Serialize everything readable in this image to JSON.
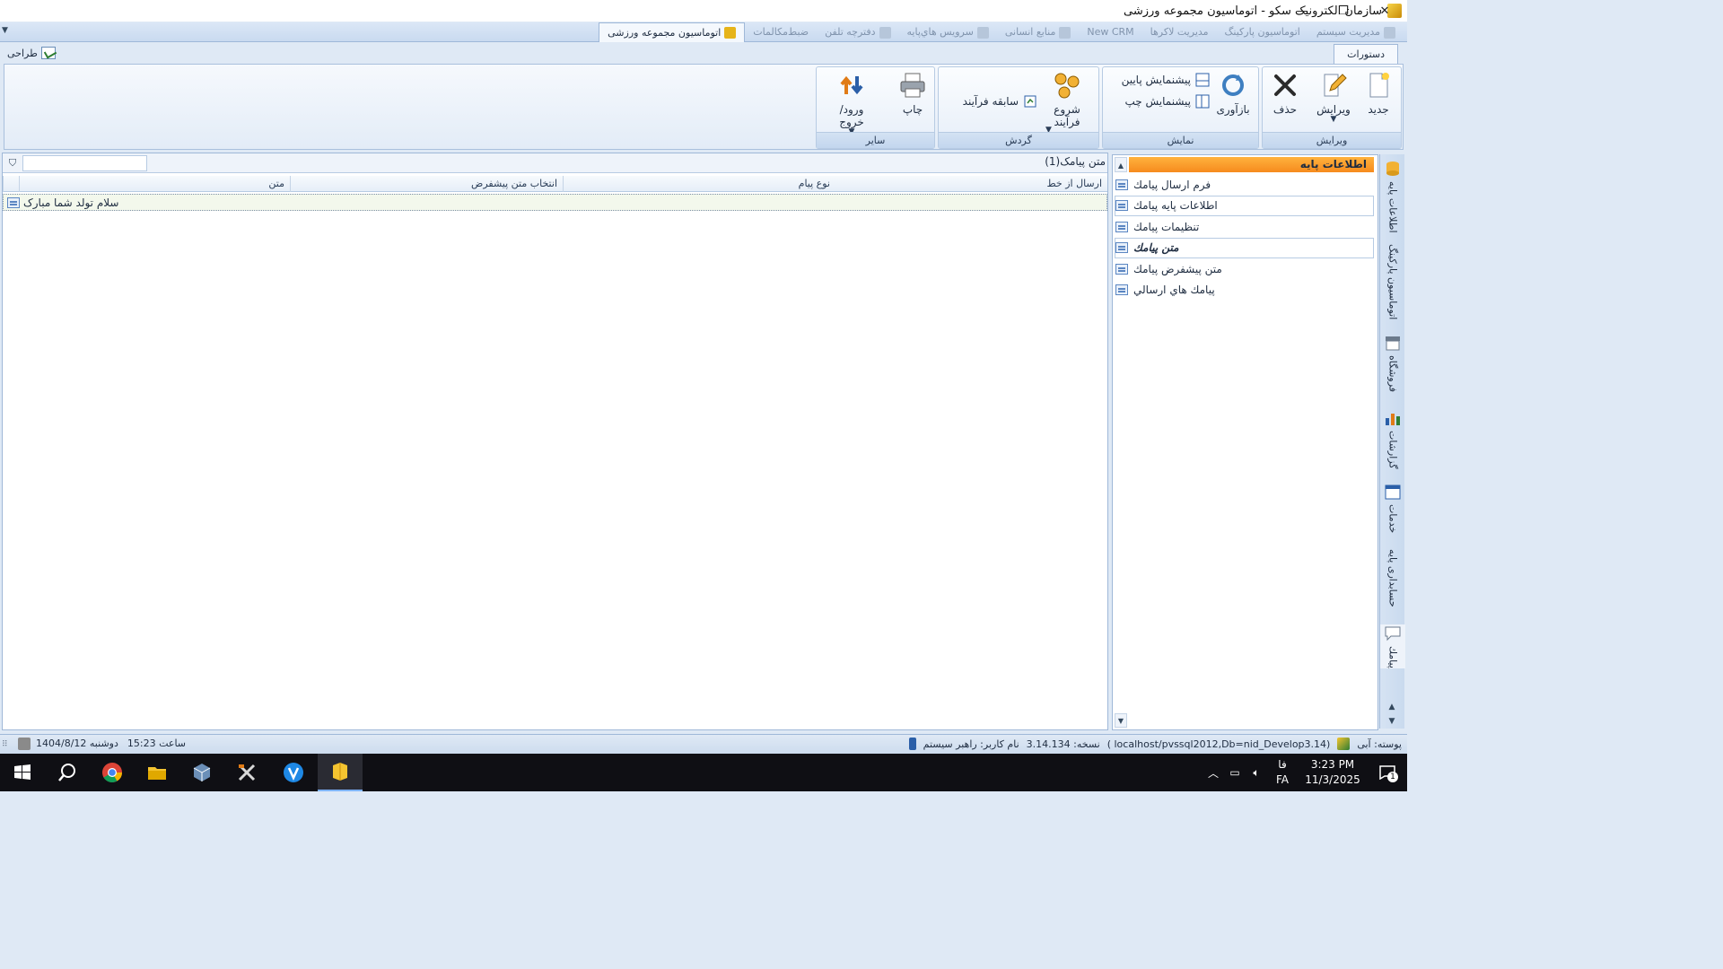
{
  "window": {
    "title": "سازمان الکترونیک سکو - اتوماسیون مجموعه ورزشی",
    "controls": {
      "minimize": "—",
      "restore": "❐",
      "close": "✕"
    }
  },
  "module_tabs": [
    {
      "label": "اتوماسيون مجموعه ورزشی",
      "active": true
    },
    {
      "label": "ضبط‌مکالمات",
      "active": false
    },
    {
      "label": "دفترچه تلفن",
      "active": false
    },
    {
      "label": "سرويس هاي‌پايه",
      "active": false
    },
    {
      "label": "منابع انسانی",
      "active": false
    },
    {
      "label": "New CRM",
      "active": false
    },
    {
      "label": "مديريت لاکرها",
      "active": false
    },
    {
      "label": "اتوماسيون پارکينگ",
      "active": false
    },
    {
      "label": "مديريت سيستم",
      "active": false
    }
  ],
  "command_tab": {
    "label": "دستورات"
  },
  "design_button": {
    "label": "طراحی"
  },
  "ribbon": {
    "groups": {
      "edit": "ویرایش",
      "view": "نمایش",
      "flow": "گردش",
      "other": "سایر"
    },
    "buttons": {
      "new": "جدید",
      "edit": "ویرایش",
      "delete": "حذف",
      "refresh": "بازآوری",
      "preview_bottom": "پیشنمایش پایین",
      "preview_left": "پیشنمایش چپ",
      "start_process_1": "شروع",
      "start_process_2": "فرآیند",
      "process_history": "سابقه فرآیند",
      "print": "چاپ",
      "import_export": "ورود/خروج"
    }
  },
  "nav": {
    "header": "اطلاعات پایه",
    "items": [
      {
        "label": "فرم ارسال پيامك"
      },
      {
        "label": "اطلاعات پايه پيامك"
      },
      {
        "label": "تنظيمات پيامك"
      },
      {
        "label": "متن پيامك"
      },
      {
        "label": "متن پيشفرض پيامك"
      },
      {
        "label": "پيامك هاي ارسالي"
      }
    ]
  },
  "sidebar_modules": [
    {
      "label": "اطلاعات پايه"
    },
    {
      "label": "اتوماسيون پارکينگ"
    },
    {
      "label": "فروشگاه"
    },
    {
      "label": "گزارشات"
    },
    {
      "label": "خدمات"
    },
    {
      "label": "حسابداری پايه"
    },
    {
      "label": "پيامك"
    }
  ],
  "grid": {
    "title": "متن پیامک(1)",
    "filter_value": "",
    "columns": [
      "متن",
      "انتخاب متن پیشفرض",
      "نوع پیام",
      "ارسال از خط"
    ],
    "rows": [
      {
        "text": "سلام تولد شما مبارک",
        "default_text": "",
        "type": "",
        "line": ""
      }
    ]
  },
  "status": {
    "user": "نام کاربر: راهبر سیستم",
    "version": "نسخه: 3.14.134",
    "db": "(localhost/pvssql2012,Db=nid_Develop3.14 )",
    "skin": "پوسته: آبی",
    "date": "دوشنبه  1404/8/12",
    "time": "ساعت  15:23"
  },
  "taskbar": {
    "time": "3:23 PM",
    "date": "11/3/2025",
    "lang_top": "فا",
    "lang_bottom": "FA",
    "notif_count": "1"
  }
}
